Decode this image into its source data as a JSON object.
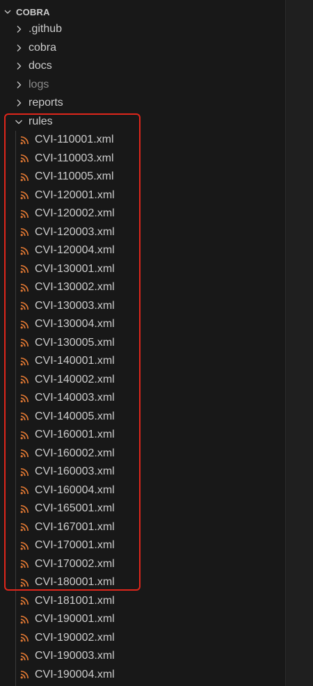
{
  "explorer": {
    "section_title": "COBRA",
    "folders": [
      {
        "label": ".github",
        "dim": false
      },
      {
        "label": "cobra",
        "dim": false
      },
      {
        "label": "docs",
        "dim": false
      },
      {
        "label": "logs",
        "dim": true
      },
      {
        "label": "reports",
        "dim": false
      }
    ],
    "open_folder": {
      "label": "rules"
    },
    "files": [
      "CVI-110001.xml",
      "CVI-110003.xml",
      "CVI-110005.xml",
      "CVI-120001.xml",
      "CVI-120002.xml",
      "CVI-120003.xml",
      "CVI-120004.xml",
      "CVI-130001.xml",
      "CVI-130002.xml",
      "CVI-130003.xml",
      "CVI-130004.xml",
      "CVI-130005.xml",
      "CVI-140001.xml",
      "CVI-140002.xml",
      "CVI-140003.xml",
      "CVI-140005.xml",
      "CVI-160001.xml",
      "CVI-160002.xml",
      "CVI-160003.xml",
      "CVI-160004.xml",
      "CVI-165001.xml",
      "CVI-167001.xml",
      "CVI-170001.xml",
      "CVI-170002.xml",
      "CVI-180001.xml",
      "CVI-181001.xml",
      "CVI-190001.xml",
      "CVI-190002.xml",
      "CVI-190003.xml",
      "CVI-190004.xml"
    ]
  },
  "colors": {
    "rss_icon": "#e37933",
    "highlight_border": "#e0261b",
    "background": "#181818"
  },
  "icons": {
    "folder_collapsed": "chevron-right-icon",
    "folder_expanded": "chevron-down-icon",
    "file": "rss-icon"
  }
}
